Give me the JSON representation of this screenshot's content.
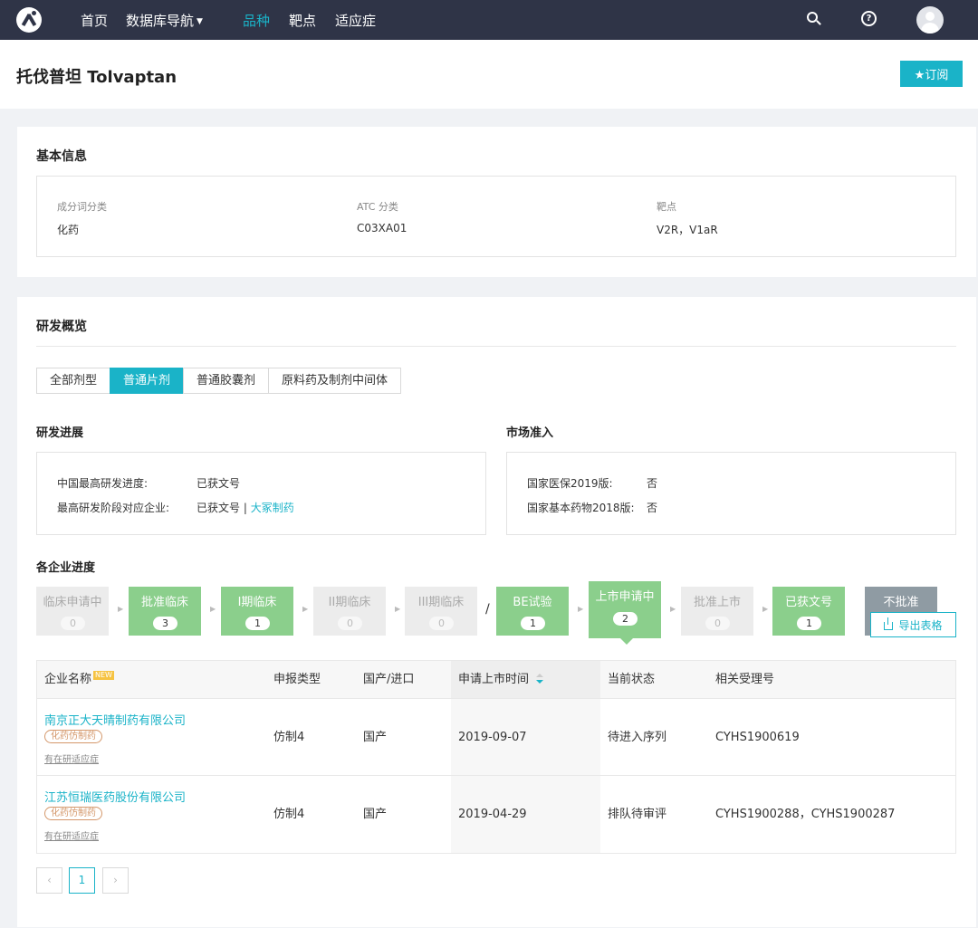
{
  "nav": {
    "items": [
      "首页",
      "数据库导航",
      "品种",
      "靶点",
      "适应症"
    ],
    "active_index": 2
  },
  "header": {
    "title": "托伐普坦 Tolvaptan",
    "subscribe_label": "★订阅"
  },
  "basic": {
    "title": "基本信息",
    "fields": [
      {
        "label": "成分词分类",
        "value": "化药"
      },
      {
        "label": "ATC 分类",
        "value": "C03XA01"
      },
      {
        "label": "靶点",
        "value": "V2R，V1aR"
      }
    ]
  },
  "rd": {
    "title": "研发概览",
    "tabs": [
      "全部剂型",
      "普通片剂",
      "普通胶囊剂",
      "原料药及制剂中间体"
    ],
    "active_tab": 1,
    "progress": {
      "title": "研发进展",
      "rows": [
        {
          "key": "中国最高研发进度:",
          "value": "已获文号"
        },
        {
          "key": "最高研发阶段对应企业:",
          "value": "已获文号 | ",
          "link": "大冢制药"
        }
      ]
    },
    "market": {
      "title": "市场准入",
      "rows": [
        {
          "key": "国家医保2019版:",
          "value": "否"
        },
        {
          "key": "国家基本药物2018版:",
          "value": "否"
        }
      ]
    },
    "pipeline_title": "各企业进度",
    "stages": [
      {
        "label": "临床申请中",
        "count": "0",
        "active": false
      },
      {
        "label": "批准临床",
        "count": "3",
        "active": true
      },
      {
        "label": "I期临床",
        "count": "1",
        "active": true
      },
      {
        "label": "II期临床",
        "count": "0",
        "active": false
      },
      {
        "label": "III期临床",
        "count": "0",
        "active": false
      },
      {
        "label": "BE试验",
        "count": "1",
        "active": true
      },
      {
        "label": "上市申请中",
        "count": "2",
        "active": true
      },
      {
        "label": "批准上市",
        "count": "0",
        "active": false
      },
      {
        "label": "已获文号",
        "count": "1",
        "active": true
      },
      {
        "label": "不批准",
        "count": "",
        "active": false
      }
    ],
    "slash": "/",
    "export_label": "导出表格",
    "table": {
      "headers": [
        "企业名称",
        "申报类型",
        "国产/进口",
        "申请上市时间",
        "当前状态",
        "相关受理号"
      ],
      "new_badge": "NEW",
      "rows": [
        {
          "company": "南京正大天晴制药有限公司",
          "tag": "化药仿制药",
          "sub": "有在研适应症",
          "type": "仿制4",
          "origin": "国产",
          "date": "2019-09-07",
          "status": "待进入序列",
          "numbers": "CYHS1900619"
        },
        {
          "company": "江苏恒瑞医药股份有限公司",
          "tag": "化药仿制药",
          "sub": "有在研适应症",
          "type": "仿制4",
          "origin": "国产",
          "date": "2019-04-29",
          "status": "排队待审评",
          "numbers": "CYHS1900288，CYHS1900287"
        }
      ]
    },
    "pagination": {
      "prev": "‹",
      "current": "1",
      "next": "›"
    }
  }
}
